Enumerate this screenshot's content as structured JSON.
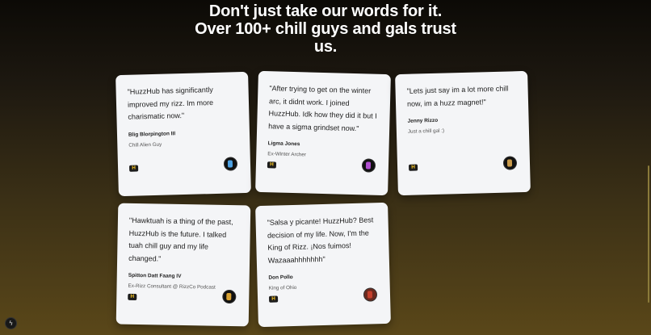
{
  "headline": {
    "line1": "Don't just take our words for it.",
    "line2": "Over 100+ chill guys and gals trust",
    "line3": "us."
  },
  "testimonials": [
    {
      "quote": "\"HuzzHub has significantly improved my rizz. Im more charismatic now.\"",
      "author": "Blig Blorpington III",
      "role": "Chill Alien Guy",
      "avatar_icon": "alien-avatar-icon",
      "badge_icon": "brand-badge-icon"
    },
    {
      "quote": "\"After trying to get on the winter arc, it didnt work. I joined HuzzHub. Idk how they did it but I have a sigma grindset now.\"",
      "author": "Ligma Jones",
      "role": "Ex-Winter Archer",
      "avatar_icon": "archer-avatar-icon",
      "badge_icon": "brand-badge-icon"
    },
    {
      "quote": "\"Lets just say im a lot more chill now, im a huzz magnet!\"",
      "author": "Jenny Rizzo",
      "role": "Just a chill gal :)",
      "avatar_icon": "gal-avatar-icon",
      "badge_icon": "brand-badge-icon"
    },
    {
      "quote": "\"Hawktuah is a thing of the past, HuzzHub is the future. I talked tuah chill guy and my life changed.\"",
      "author": "Spitton Datt Faang IV",
      "role": "Ex-Rizz Consultant @ RizzCo Podcast",
      "avatar_icon": "consultant-avatar-icon",
      "badge_icon": "brand-badge-icon"
    },
    {
      "quote": "\"Salsa y picante! HuzzHub? Best decision of my life. Now, I'm the King of Rizz. ¡Nos fuimos! Wazaaahhhhhhh\"",
      "author": "Don Pollo",
      "role": "King of Ohio",
      "avatar_icon": "don-avatar-icon",
      "badge_icon": "brand-badge-icon"
    }
  ],
  "colors": {
    "accent": "#e1b423",
    "card_bg": "#f4f5f7"
  },
  "corner_button_icon": "lightning-icon",
  "corner_button_glyph": "ϟ"
}
